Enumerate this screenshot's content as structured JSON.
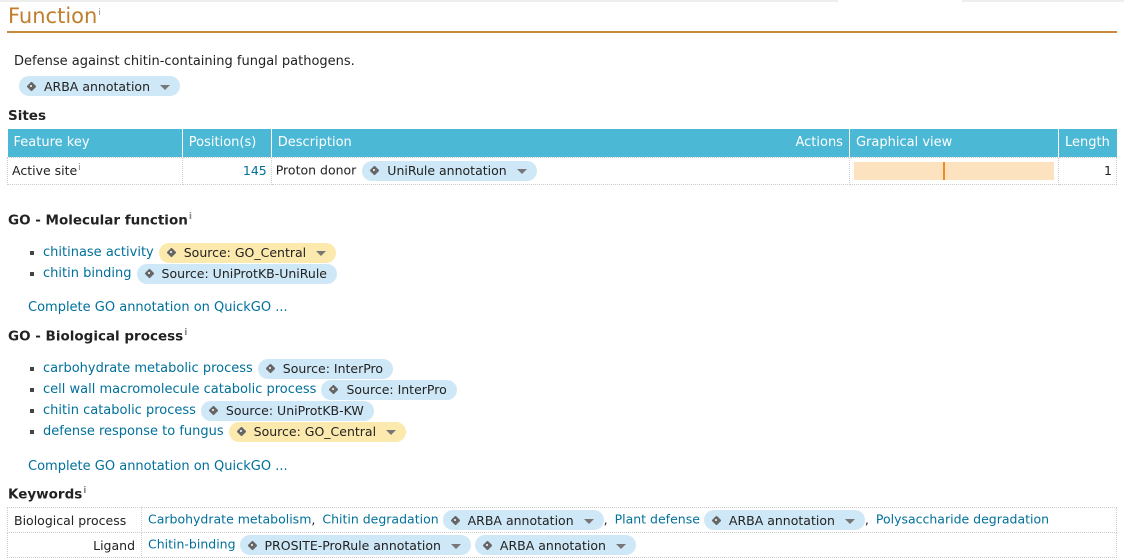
{
  "section": {
    "title": "Function",
    "info_mark": "i"
  },
  "function_text": "Defense against chitin-containing fungal pathogens.",
  "function_evidence": {
    "label": "ARBA annotation"
  },
  "sites": {
    "heading": "Sites",
    "columns": [
      "Feature key",
      "Position(s)",
      "Description",
      "Actions",
      "Graphical view",
      "Length"
    ],
    "rows": [
      {
        "feature_key": "Active site",
        "info_mark": "i",
        "position": "145",
        "description": "Proton donor",
        "evidence": "UniRule annotation",
        "length": "1",
        "marker_fraction": 0.445
      }
    ]
  },
  "go_molecular": {
    "heading": "GO - Molecular function",
    "info_mark": "i",
    "items": [
      {
        "term": "chitinase activity",
        "source": "Source: GO_Central",
        "color": "yellow"
      },
      {
        "term": "chitin binding",
        "source": "Source: UniProtKB-UniRule",
        "color": "blue"
      }
    ],
    "complete_link": "Complete GO annotation on QuickGO ..."
  },
  "go_biological": {
    "heading": "GO - Biological process",
    "info_mark": "i",
    "items": [
      {
        "term": "carbohydrate metabolic process",
        "source": "Source: InterPro",
        "color": "blue"
      },
      {
        "term": "cell wall macromolecule catabolic process",
        "source": "Source: InterPro",
        "color": "blue"
      },
      {
        "term": "chitin catabolic process",
        "source": "Source: UniProtKB-KW",
        "color": "blue"
      },
      {
        "term": "defense response to fungus",
        "source": "Source: GO_Central",
        "color": "yellow"
      }
    ],
    "complete_link": "Complete GO annotation on QuickGO ..."
  },
  "keywords": {
    "heading": "Keywords",
    "info_mark": "i",
    "biological_process": {
      "label": "Biological process",
      "kw1": "Carbohydrate metabolism",
      "kw2": "Chitin degradation",
      "kw2_evidence": "ARBA annotation",
      "kw3": "Plant defense",
      "kw3_evidence": "ARBA annotation",
      "kw4": "Polysaccharide degradation",
      "comma": ","
    },
    "ligand": {
      "label": "Ligand",
      "kw1": "Chitin-binding",
      "ev1": "PROSITE-ProRule annotation",
      "ev2": "ARBA annotation"
    }
  },
  "colors": {
    "title": "#c17e2c",
    "table_header": "#4bb8d6",
    "link": "#00709b",
    "pill_blue": "#cfe8f7",
    "pill_yellow": "#fce9ad",
    "graph_bar": "#fde2bf",
    "graph_marker": "#f08a1c"
  }
}
